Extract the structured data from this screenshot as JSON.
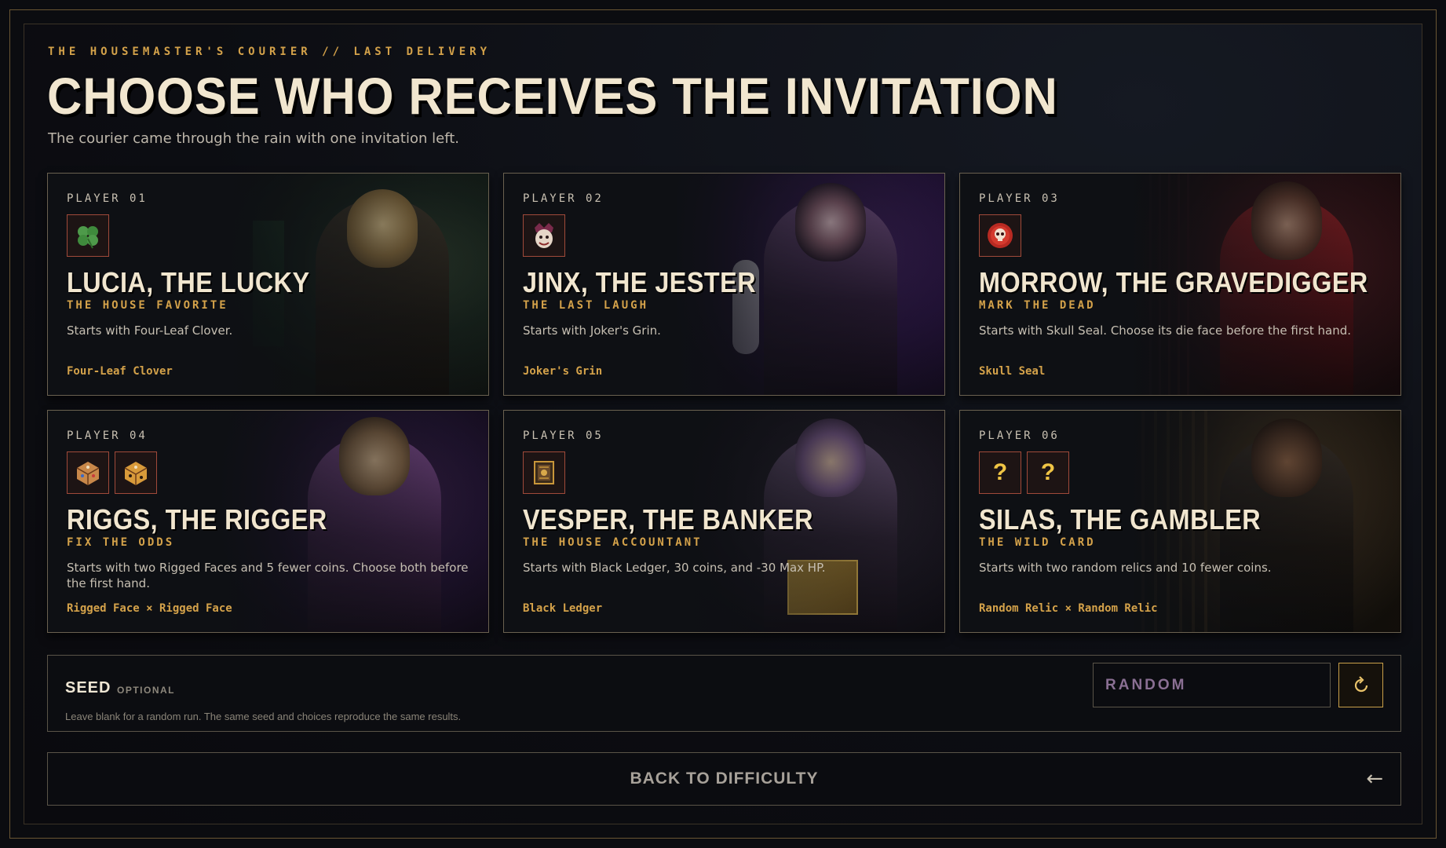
{
  "header": {
    "kicker": "THE HOUSEMASTER'S COURIER // LAST DELIVERY",
    "title": "CHOOSE WHO RECEIVES THE INVITATION",
    "subtitle": "The courier came through the rain with one invitation left."
  },
  "characters": [
    {
      "player": "PLAYER 01",
      "name": "LUCIA, THE LUCKY",
      "epithet": "THE HOUSE FAVORITE",
      "description": "Starts with Four-Leaf Clover.",
      "relics_text": "Four-Leaf Clover",
      "relic_icons": [
        "clover-icon"
      ],
      "accent": "#2e6b3a"
    },
    {
      "player": "PLAYER 02",
      "name": "JINX, THE JESTER",
      "epithet": "THE LAST LAUGH",
      "description": "Starts with Joker's Grin.",
      "relics_text": "Joker's Grin",
      "relic_icons": [
        "joker-mask-icon"
      ],
      "accent": "#5a2d7a"
    },
    {
      "player": "PLAYER 03",
      "name": "MORROW, THE GRAVEDIGGER",
      "epithet": "MARK THE DEAD",
      "description": "Starts with Skull Seal. Choose its die face before the first hand.",
      "relics_text": "Skull Seal",
      "relic_icons": [
        "skull-seal-icon"
      ],
      "accent": "#7a1e1e"
    },
    {
      "player": "PLAYER 04",
      "name": "RIGGS, THE RIGGER",
      "epithet": "FIX THE ODDS",
      "description": "Starts with two Rigged Faces and 5 fewer coins. Choose both before the first hand.",
      "relics_text": "Rigged Face × Rigged Face",
      "relic_icons": [
        "rigged-die-icon",
        "rigged-die-icon"
      ],
      "accent": "#6a3a82"
    },
    {
      "player": "PLAYER 05",
      "name": "VESPER, THE BANKER",
      "epithet": "THE HOUSE ACCOUNTANT",
      "description": "Starts with Black Ledger, 30 coins, and -30 Max HP.",
      "relics_text": "Black Ledger",
      "relic_icons": [
        "ledger-icon"
      ],
      "accent": "#6a4a8a"
    },
    {
      "player": "PLAYER 06",
      "name": "SILAS, THE GAMBLER",
      "epithet": "THE WILD CARD",
      "description": "Starts with two random relics and 10 fewer coins.",
      "relics_text": "Random Relic × Random Relic",
      "relic_icons": [
        "question-mark-icon",
        "question-mark-icon"
      ],
      "relic_glyph": "?",
      "accent": "#7a5a2a"
    }
  ],
  "seed": {
    "title": "SEED",
    "optional": "OPTIONAL",
    "help": "Leave blank for a random run. The same seed and choices reproduce the same results.",
    "placeholder": "RANDOM",
    "value": ""
  },
  "footer": {
    "back_label": "BACK TO DIFFICULTY",
    "back_arrow": "←"
  }
}
